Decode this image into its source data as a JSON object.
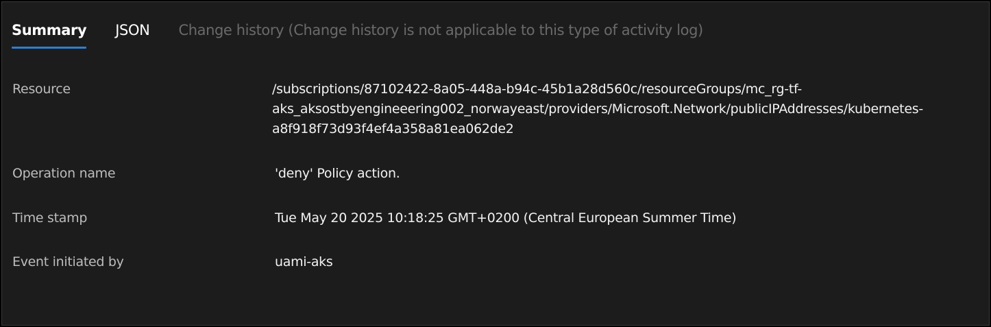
{
  "tabs": [
    {
      "label": "Summary",
      "state": "active"
    },
    {
      "label": "JSON",
      "state": "normal"
    },
    {
      "label": "Change history (Change history is not applicable to this type of activity log)",
      "state": "disabled"
    }
  ],
  "details": {
    "resource": {
      "label": "Resource",
      "value_lines": [
        "/subscriptions/87102422-8a05-448a-b94c-45b1a28d560c/resourceGroups/mc_rg-tf-",
        "aks_aksostbyengineeering002_norwayeast/providers/Microsoft.Network/publicIPAddresses/kubernetes-",
        "a8f918f73d93f4ef4a358a81ea062de2"
      ]
    },
    "operation_name": {
      "label": "Operation name",
      "value": "'deny' Policy action."
    },
    "time_stamp": {
      "label": "Time stamp",
      "value": "Tue May 20 2025 10:18:25 GMT+0200 (Central European Summer Time)"
    },
    "event_initiated_by": {
      "label": "Event initiated by",
      "value": "uami-aks"
    }
  },
  "colors": {
    "background": "#1c1c1c",
    "accent": "#2f7fd0",
    "label": "#bdbdbd",
    "text": "#f2f2f2",
    "disabled_tab": "#6a6a6a"
  }
}
